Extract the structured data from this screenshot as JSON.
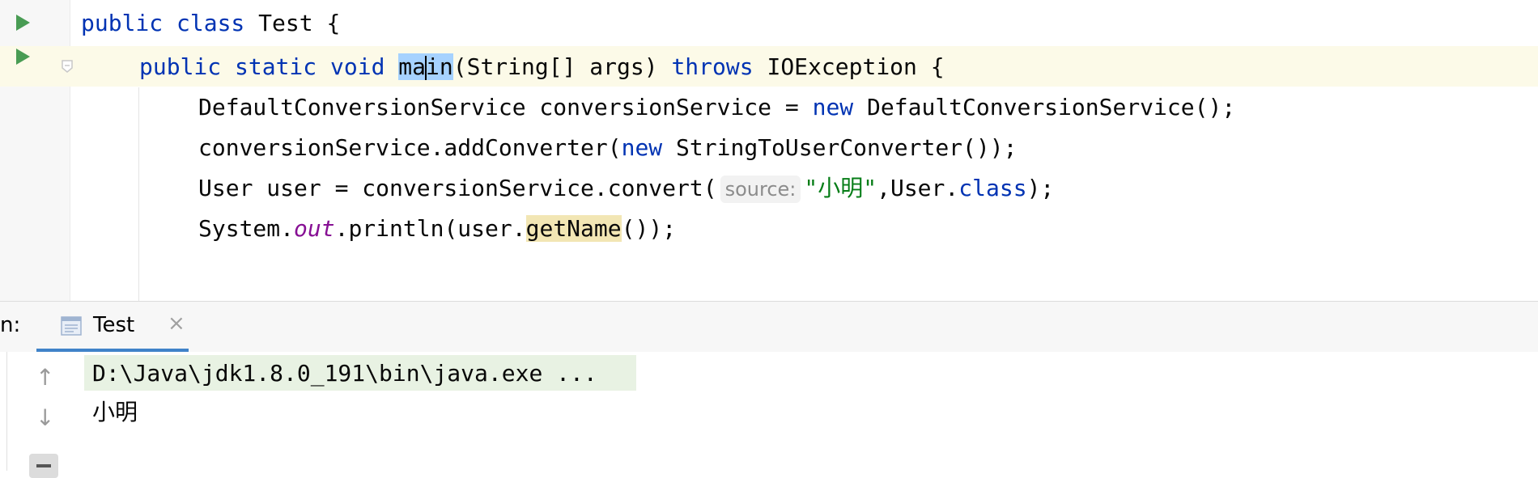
{
  "editor": {
    "lines": [
      {
        "parts": [
          "public class",
          " Test {"
        ]
      },
      {
        "parts": [
          "public static void",
          " ",
          "ma",
          "in",
          "(String[] args) ",
          "throws",
          " IOException {"
        ]
      },
      {
        "parts": [
          "DefaultConversionService conversionService = ",
          "new",
          " DefaultConversionService();"
        ]
      },
      {
        "parts": [
          "conversionService.addConverter(",
          "new",
          " StringToUserConverter());"
        ]
      },
      {
        "parts": [
          "User user = conversionService.convert(",
          "source:",
          "\"小明\"",
          ",User.",
          "class",
          ");"
        ]
      },
      {
        "parts": [
          "System.",
          "out",
          ".println(user.",
          "getName",
          "());"
        ]
      }
    ],
    "gutter_icons": [
      "run-icon",
      "run-icon",
      "bookmark-icon"
    ]
  },
  "run_panel": {
    "title": "n:",
    "tab": {
      "label": "Test",
      "close": "×"
    },
    "tool_icons": {
      "up": "↑",
      "down": "↓"
    },
    "console": {
      "command": "D:\\Java\\jdk1.8.0_191\\bin\\java.exe ...",
      "output": "小明"
    }
  }
}
